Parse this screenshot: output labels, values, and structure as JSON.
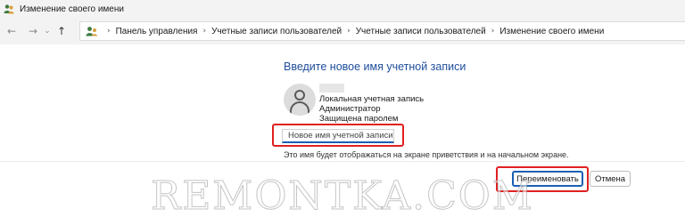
{
  "window": {
    "title": "Изменение своего имени",
    "icon": "user-accounts-icon"
  },
  "navigation": {
    "back_icon": "arrow-left-icon",
    "forward_icon": "arrow-right-icon",
    "history_icon": "chevron-down-icon",
    "up_icon": "arrow-up-icon",
    "back_glyph": "←",
    "forward_glyph": "→",
    "history_glyph": "⌄",
    "up_glyph": "↑",
    "separator": "›",
    "breadcrumbs": [
      "Панель управления",
      "Учетные записи пользователей",
      "Учетные записи пользователей",
      "Изменение своего имени"
    ]
  },
  "main": {
    "heading": "Введите новое имя учетной записи",
    "account": {
      "type": "Локальная учетная запись",
      "role": "Администратор",
      "protection": "Защищена паролем"
    },
    "new_name_input": {
      "value": "",
      "placeholder": "Новое имя учетной записи"
    },
    "hint": "Это имя будет отображаться на экране приветствия и на начальном экране."
  },
  "buttons": {
    "rename": "Переименовать",
    "cancel": "Отмена"
  },
  "watermark": "REMONTKA.COM",
  "colors": {
    "accent": "#1a5fb4",
    "heading": "#1e4e9c",
    "highlight": "#e02020"
  }
}
